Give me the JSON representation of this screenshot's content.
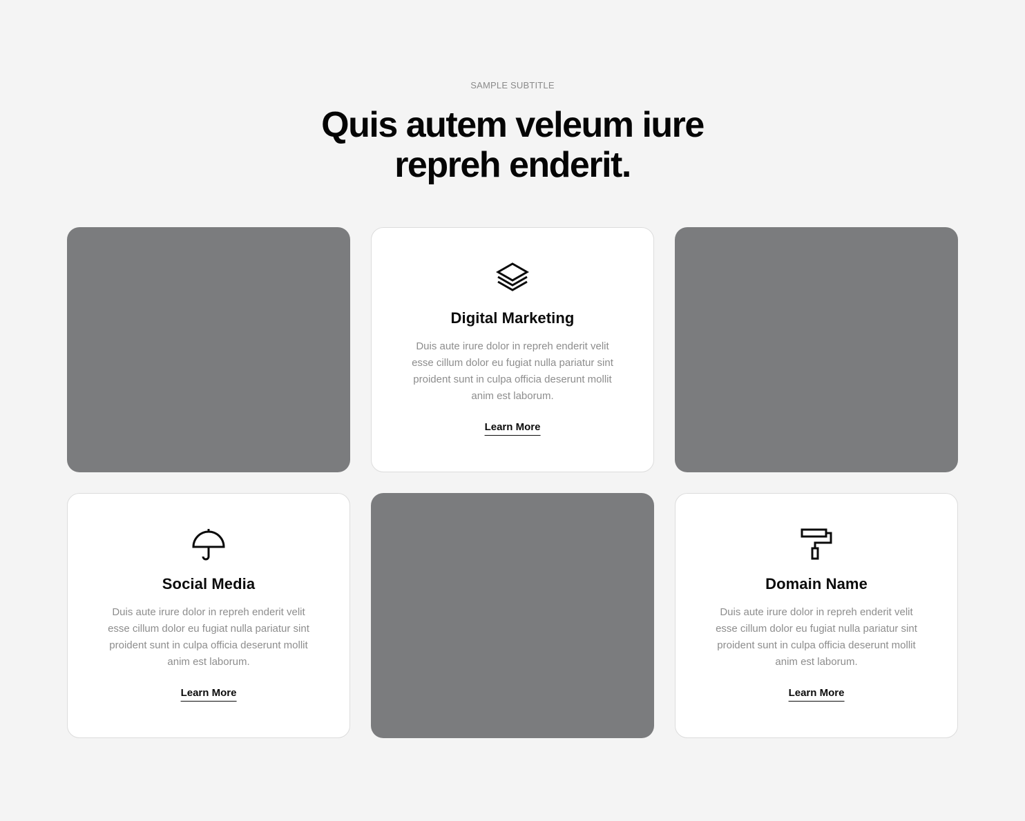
{
  "section": {
    "subtitle": "SAMPLE SUBTITLE",
    "title_line1": "Quis autem veleum iure",
    "title_line2": "repreh enderit."
  },
  "colors": {
    "background": "#f4f4f4",
    "placeholder": "#7b7c7e",
    "card": "#ffffff",
    "text_dark": "#0b0b0b",
    "text_muted": "#8d8d8d"
  },
  "cards": [
    {
      "type": "image"
    },
    {
      "type": "service",
      "icon": "layers-icon",
      "title": "Digital Marketing",
      "text": "Duis aute irure dolor in repreh enderit velit esse cillum dolor eu fugiat nulla pariatur sint proident sunt in culpa officia deserunt mollit anim est laborum.",
      "link": "Learn More"
    },
    {
      "type": "image"
    },
    {
      "type": "service",
      "icon": "umbrella-icon",
      "title": "Social Media",
      "text": "Duis aute irure dolor in repreh enderit velit esse cillum dolor eu fugiat nulla pariatur sint proident sunt in culpa officia deserunt mollit anim est laborum.",
      "link": "Learn More"
    },
    {
      "type": "image"
    },
    {
      "type": "service",
      "icon": "paint-roller-icon",
      "title": "Domain Name",
      "text": "Duis aute irure dolor in repreh enderit velit esse cillum dolor eu fugiat nulla pariatur sint proident sunt in culpa officia deserunt mollit anim est laborum.",
      "link": "Learn More"
    }
  ]
}
